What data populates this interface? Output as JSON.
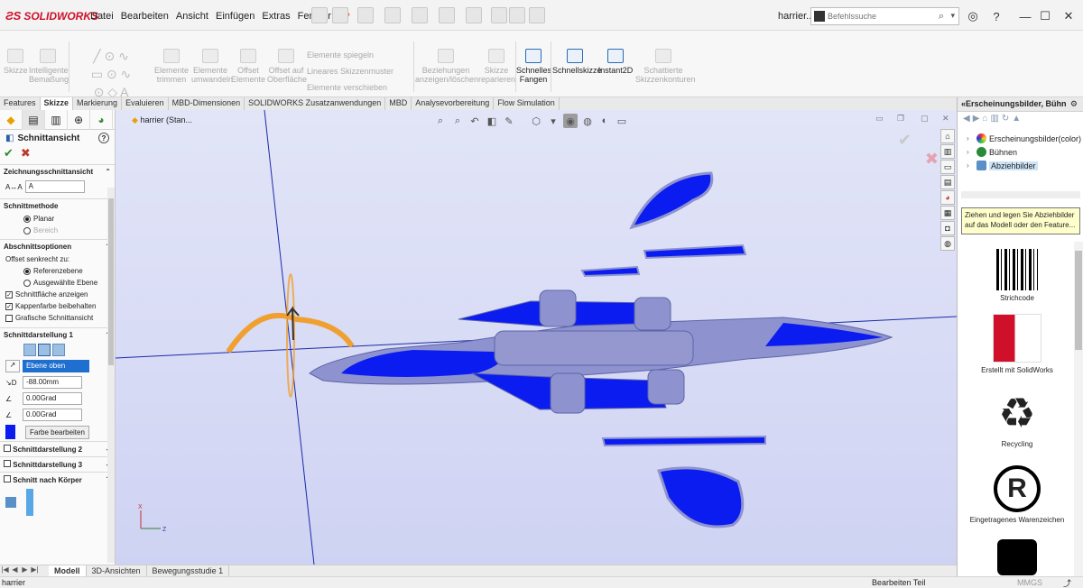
{
  "app": {
    "logo_text": "SOLIDWORKS",
    "document_title": "harrier....",
    "colors": {
      "accent": "#d0102a",
      "viewport_bg": "#d6d9f5",
      "section_fill": "#0a1cf0",
      "body_color": "#8e93cf"
    }
  },
  "menu": [
    "Datei",
    "Bearbeiten",
    "Ansicht",
    "Einfügen",
    "Extras",
    "Fenster"
  ],
  "search": {
    "placeholder": "Befehlssuche"
  },
  "commands": [
    {
      "label": "Skizze",
      "active": false
    },
    {
      "label": "Intelligente\nBemaßung",
      "active": false
    },
    {
      "label": "Elemente\ntrimmen",
      "active": false
    },
    {
      "label": "Elemente\numwandeln",
      "active": false
    },
    {
      "label": "Offset\nElemente",
      "active": false
    },
    {
      "label": "Offset auf\nOberfläche",
      "active": false
    },
    {
      "label": "Elemente spiegeln",
      "active": false
    },
    {
      "label": "Lineares Skizzenmuster",
      "active": false
    },
    {
      "label": "Elemente verschieben",
      "active": false
    },
    {
      "label": "Beziehungen\nanzeigen/löschen",
      "active": false
    },
    {
      "label": "Skizze\nreparieren",
      "active": false
    },
    {
      "label": "Schnelles\nFangen",
      "active": true
    },
    {
      "label": "Schnellskizze",
      "active": true
    },
    {
      "label": "Instant2D",
      "active": true
    },
    {
      "label": "Schattierte\nSkizzenkonturen",
      "active": false
    }
  ],
  "tabs": [
    "Features",
    "Skizze",
    "Markierung",
    "Evaluieren",
    "MBD-Dimensionen",
    "SOLIDWORKS Zusatzanwendungen",
    "MBD",
    "Analysevorbereitung",
    "Flow Simulation"
  ],
  "selected_tab": "Skizze",
  "property_manager": {
    "title": "Schnittansicht",
    "help": "?",
    "sections": {
      "zeichnung": "Zeichnungsschnittansicht",
      "zeichnung_value": "A",
      "methode": "Schnittmethode",
      "methode_options": [
        "Planar",
        "Bereich"
      ],
      "optionen": "Abschnittsoptionen",
      "offset_label": "Offset senkrecht zu:",
      "offset_options": [
        "Referenzebene",
        "Ausgewählte Ebene"
      ],
      "checkboxes": [
        {
          "label": "Schnittfläche anzeigen",
          "checked": true
        },
        {
          "label": "Kappenfarbe beibehalten",
          "checked": true
        },
        {
          "label": "Grafische Schnittansicht",
          "checked": false
        }
      ],
      "darstellung1": "Schnittdarstellung 1",
      "plane": "Ebene oben",
      "distance": "-88.00mm",
      "angle1": "0.00Grad",
      "angle2": "0.00Grad",
      "edit_color": "Farbe bearbeiten",
      "darstellung2": "Schnittdarstellung 2",
      "darstellung3": "Schnittdarstellung 3",
      "nach_koerper": "Schnitt nach Körper"
    }
  },
  "viewport": {
    "tree_label": "harrier  (Stan..."
  },
  "bottom_tabs": [
    "Modell",
    "3D-Ansichten",
    "Bewegungsstudie 1"
  ],
  "status": {
    "left": "harrier",
    "mode": "Bearbeiten Teil",
    "units": "MMGS"
  },
  "task_pane": {
    "title": "Erscheinungsbilder, Bühn",
    "tree": [
      "Erscheinungsbilder(color)",
      "Bühnen",
      "Abziehbilder"
    ],
    "tooltip": "Ziehen und legen Sie Abziehbilder auf das Modell oder den Feature...",
    "decals": [
      "Strichcode",
      "Erstellt mit SolidWorks",
      "Recycling",
      "Eingetragenes Warenzeichen"
    ]
  }
}
